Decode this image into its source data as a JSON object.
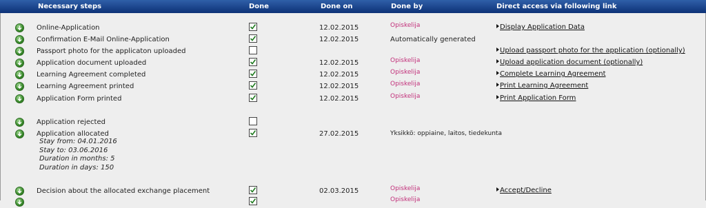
{
  "header": {
    "col_steps": "Necessary steps",
    "col_done": "Done",
    "col_done_on": "Done on",
    "col_done_by": "Done by",
    "col_link": "Direct access via following link"
  },
  "rows": [
    {
      "step": "Online-Application",
      "done": true,
      "date": "12.02.2015",
      "by": "Opiskelija",
      "link": "Display Application Data"
    },
    {
      "step": "Confirmation E-Mail Online-Application",
      "done": true,
      "date": "12.02.2015",
      "by": "Automatically generated",
      "link": ""
    },
    {
      "step": "Passport photo for the applicaton uploaded",
      "done": false,
      "date": "",
      "by": "",
      "link": "Upload passport photo for the application (optionally)"
    },
    {
      "step": "Application document uploaded",
      "done": true,
      "date": "12.02.2015",
      "by": "Opiskelija",
      "link": "Upload application document (optionally)"
    },
    {
      "step": "Learning Agreement completed",
      "done": true,
      "date": "12.02.2015",
      "by": "Opiskelija",
      "link": "Complete Learning Agreement"
    },
    {
      "step": "Learning Agreement printed",
      "done": true,
      "date": "12.02.2015",
      "by": "Opiskelija",
      "link": "Print Learning Agreement"
    },
    {
      "step": "Application Form printed",
      "done": true,
      "date": "12.02.2015",
      "by": "Opiskelija",
      "link": "Print Application Form"
    },
    {
      "step": "Application rejected",
      "done": false,
      "date": "",
      "by": "",
      "link": ""
    },
    {
      "step": "Application allocated",
      "done": true,
      "date": "27.02.2015",
      "by": "Yksikkö: oppiaine, laitos, tiedekunta",
      "link": ""
    },
    {
      "step": "Decision about the allocated exchange placement",
      "done": true,
      "date": "02.03.2015",
      "by": "Opiskelija",
      "link": "Accept/Decline"
    },
    {
      "step": "",
      "done": true,
      "date": "",
      "by": "Opiskelija",
      "link": ""
    }
  ],
  "allocation_details": {
    "stay_from": "Stay from: 04.01.2016",
    "stay_to": "Stay to: 03.06.2016",
    "duration_months": "Duration in months: 5",
    "duration_days": "Duration in days: 150"
  },
  "colors": {
    "header_bg": "#1b4a92",
    "done_by_user": "#c2307a",
    "icon_green": "#3a8a2c"
  }
}
